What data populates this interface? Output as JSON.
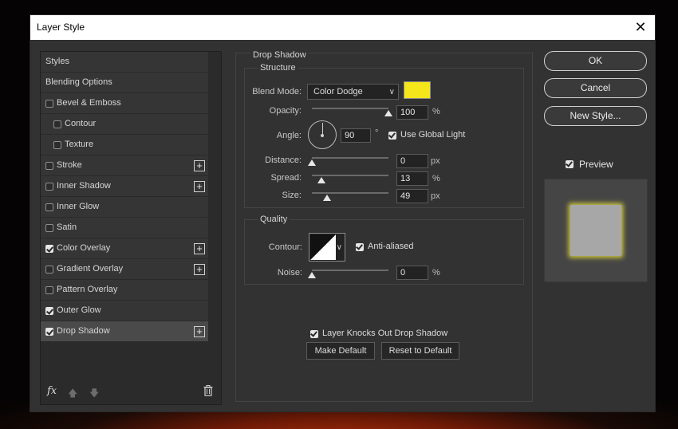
{
  "window": {
    "title": "Layer Style",
    "close_glyph": "✕"
  },
  "styles_list": {
    "items": [
      {
        "label": "Styles",
        "checkbox": false,
        "checked": false,
        "plus": false,
        "indent": 0,
        "selected": false
      },
      {
        "label": "Blending Options",
        "checkbox": false,
        "checked": false,
        "plus": false,
        "indent": 0,
        "selected": false
      },
      {
        "label": "Bevel & Emboss",
        "checkbox": true,
        "checked": false,
        "plus": false,
        "indent": 0,
        "selected": false
      },
      {
        "label": "Contour",
        "checkbox": true,
        "checked": false,
        "plus": false,
        "indent": 1,
        "selected": false
      },
      {
        "label": "Texture",
        "checkbox": true,
        "checked": false,
        "plus": false,
        "indent": 1,
        "selected": false
      },
      {
        "label": "Stroke",
        "checkbox": true,
        "checked": false,
        "plus": true,
        "indent": 0,
        "selected": false
      },
      {
        "label": "Inner Shadow",
        "checkbox": true,
        "checked": false,
        "plus": true,
        "indent": 0,
        "selected": false
      },
      {
        "label": "Inner Glow",
        "checkbox": true,
        "checked": false,
        "plus": false,
        "indent": 0,
        "selected": false
      },
      {
        "label": "Satin",
        "checkbox": true,
        "checked": false,
        "plus": false,
        "indent": 0,
        "selected": false
      },
      {
        "label": "Color Overlay",
        "checkbox": true,
        "checked": true,
        "plus": true,
        "indent": 0,
        "selected": false
      },
      {
        "label": "Gradient Overlay",
        "checkbox": true,
        "checked": false,
        "plus": true,
        "indent": 0,
        "selected": false
      },
      {
        "label": "Pattern Overlay",
        "checkbox": true,
        "checked": false,
        "plus": false,
        "indent": 0,
        "selected": false
      },
      {
        "label": "Outer Glow",
        "checkbox": true,
        "checked": true,
        "plus": false,
        "indent": 0,
        "selected": false
      },
      {
        "label": "Drop Shadow",
        "checkbox": true,
        "checked": true,
        "plus": true,
        "indent": 0,
        "selected": true
      }
    ],
    "footer": {
      "fx_label": "fx",
      "up_glyph": "🡅",
      "down_glyph": "🡇"
    }
  },
  "drop_shadow": {
    "section_title": "Drop Shadow",
    "structure": {
      "title": "Structure",
      "blend_mode": {
        "label": "Blend Mode:",
        "value": "Color Dodge"
      },
      "color": "#f5e51b",
      "opacity": {
        "label": "Opacity:",
        "value": "100",
        "unit": "%",
        "fraction": 1.0
      },
      "angle": {
        "label": "Angle:",
        "value": "90",
        "unit": "°",
        "use_global_light_label": "Use Global Light",
        "use_global_light": true
      },
      "distance": {
        "label": "Distance:",
        "value": "0",
        "unit": "px",
        "fraction": 0.0
      },
      "spread": {
        "label": "Spread:",
        "value": "13",
        "unit": "%",
        "fraction": 0.13
      },
      "size": {
        "label": "Size:",
        "value": "49",
        "unit": "px",
        "fraction": 0.2
      }
    },
    "quality": {
      "title": "Quality",
      "contour_label": "Contour:",
      "anti_aliased_label": "Anti-aliased",
      "anti_aliased": true,
      "noise": {
        "label": "Noise:",
        "value": "0",
        "unit": "%",
        "fraction": 0.0
      }
    },
    "knockout_label": "Layer Knocks Out Drop Shadow",
    "knockout": true,
    "make_default_label": "Make Default",
    "reset_default_label": "Reset to Default"
  },
  "actions": {
    "ok_label": "OK",
    "cancel_label": "Cancel",
    "new_style_label": "New Style...",
    "preview_label": "Preview",
    "preview_checked": true
  },
  "colors": {
    "accent_swatch": "#f5e51b",
    "glow": "#d8d040"
  }
}
